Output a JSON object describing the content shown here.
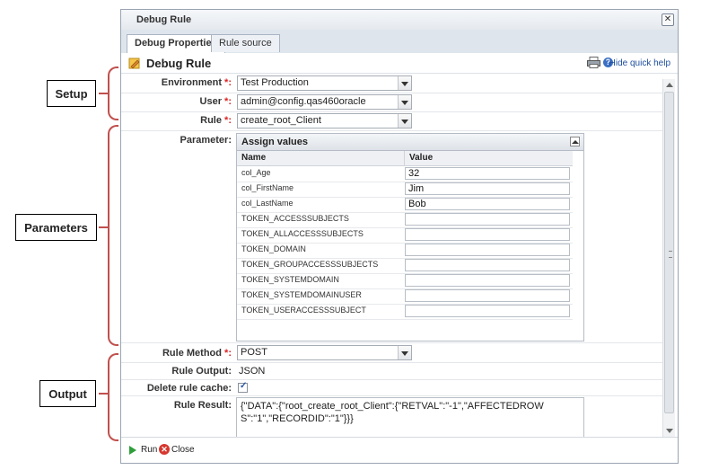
{
  "callouts": {
    "setup": "Setup",
    "parameters": "Parameters",
    "output": "Output"
  },
  "dialog": {
    "title": "Debug Rule",
    "tabs": [
      {
        "label": "Debug Properties",
        "active": true
      },
      {
        "label": "Rule source",
        "active": false
      }
    ],
    "header_title": "Debug Rule",
    "hide_help": "Hide quick help",
    "icons": [
      "rule-icon",
      "print-icon",
      "help-icon",
      "close-icon"
    ]
  },
  "form": {
    "environment": {
      "label": "Environment",
      "required": "*:",
      "value": "Test Production"
    },
    "user": {
      "label": "User",
      "required": "*:",
      "value": "admin@config.qas460oracle"
    },
    "rule": {
      "label": "Rule",
      "required": "*:",
      "value": "create_root_Client"
    },
    "parameter_label": "Parameter:",
    "rule_method": {
      "label": "Rule Method",
      "required": "*:",
      "value": "POST"
    },
    "rule_output": {
      "label": "Rule Output:",
      "value": "JSON"
    },
    "delete_cache": {
      "label": "Delete rule cache:",
      "checked": true
    },
    "rule_result": {
      "label": "Rule Result:",
      "value": "{\"DATA\":{\"root_create_root_Client\":{\"RETVAL\":\"-1\",\"AFFECTEDROWS\":\"1\",\"RECORDID\":\"1\"}}}"
    }
  },
  "assign_values": {
    "title": "Assign values",
    "columns": [
      "Name",
      "Value"
    ],
    "rows": [
      {
        "name": "col_Age",
        "value": "32"
      },
      {
        "name": "col_FirstName",
        "value": "Jim"
      },
      {
        "name": "col_LastName",
        "value": "Bob"
      },
      {
        "name": "TOKEN_ACCESSSUBJECTS",
        "value": ""
      },
      {
        "name": "TOKEN_ALLACCESSSUBJECTS",
        "value": ""
      },
      {
        "name": "TOKEN_DOMAIN",
        "value": ""
      },
      {
        "name": "TOKEN_GROUPACCESSSUBJECTS",
        "value": ""
      },
      {
        "name": "TOKEN_SYSTEMDOMAIN",
        "value": ""
      },
      {
        "name": "TOKEN_SYSTEMDOMAINUSER",
        "value": ""
      },
      {
        "name": "TOKEN_USERACCESSSUBJECT",
        "value": ""
      }
    ]
  },
  "footer": {
    "run": "Run",
    "close": "Close"
  },
  "colors": {
    "accent": "#c0504d",
    "link": "#1e4e9c",
    "required": "#dd2222"
  }
}
